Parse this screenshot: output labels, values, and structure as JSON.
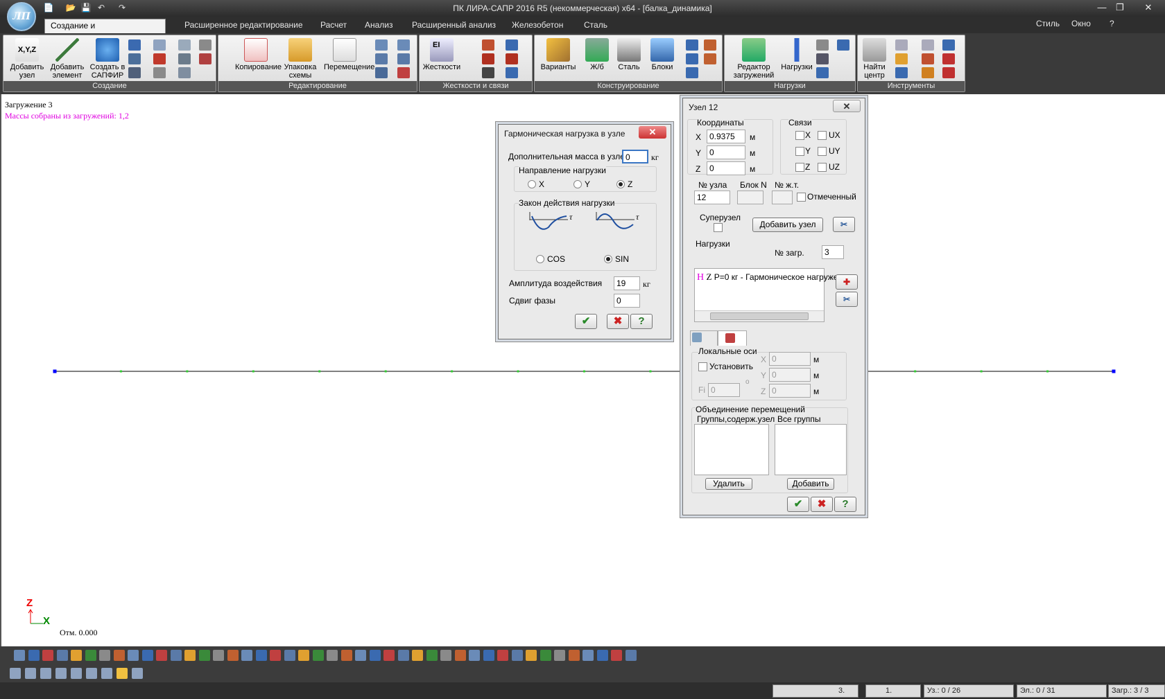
{
  "window": {
    "title": "ПК ЛИРА-САПР  2016 R5 (некоммерческая) x64 - [балка_динамика]",
    "app_logo": "ЛП",
    "minimize": "—",
    "maximize": "❐",
    "close": "✕"
  },
  "qat": {
    "new": "📄",
    "open": "📂",
    "save": "💾",
    "undo": "↶",
    "redo": "↷"
  },
  "tabs": [
    "Создание и редактирование",
    "Расширенное редактирование",
    "Расчет",
    "Анализ",
    "Расширенный анализ",
    "Железобетон",
    "Сталь"
  ],
  "right_menu": {
    "style": "Стиль",
    "window": "Окно",
    "help": "?"
  },
  "ribbon": {
    "groups": [
      "Создание",
      "Редактирование",
      "Жесткости и связи",
      "Конструирование",
      "Нагрузки",
      "Инструменты"
    ],
    "buttons": {
      "add_node": "Добавить\nузел",
      "add_element": "Добавить\nэлемент",
      "create_sapfir": "Создать в\nСАПФИР",
      "copy": "Копирование",
      "pack": "Упаковка\nсхемы",
      "move": "Перемещение",
      "stiffness": "Жесткости",
      "variants": "Варианты",
      "rc": "Ж/б",
      "steel": "Сталь",
      "blocks": "Блоки",
      "load_editor": "Редактор\nзагружений",
      "loads": "Нагрузки",
      "find_center": "Найти\nцентр"
    },
    "xyz_label": "X,Y,Z",
    "ei_label": "EI"
  },
  "canvas": {
    "load_case": "Загружение 3",
    "masses": "Массы собраны из загружений:  1,2",
    "elevation": "Отм. 0.000",
    "axis_z": "Z",
    "axis_x": "X"
  },
  "harmonic_dialog": {
    "title": "Гармоническая нагрузка в узле",
    "close": "✕",
    "extra_mass_label": "Дополнительная масса в узле",
    "extra_mass_value": "0",
    "unit_kg": "кг",
    "direction_label": "Направление нагрузки",
    "dir_x": "X",
    "dir_y": "Y",
    "dir_z": "Z",
    "dir_selected": "Z",
    "law_label": "Закон действия нагрузки",
    "cos": "COS",
    "sin": "SIN",
    "law_selected": "SIN",
    "tau": "τ",
    "amplitude_label": "Амплитуда воздействия",
    "amplitude_value": "19",
    "phase_label": "Сдвиг фазы",
    "phase_value": "0",
    "ok": "✔",
    "cancel": "✖",
    "help": "?"
  },
  "node_dialog": {
    "title": "Узел 12",
    "close": "✕",
    "coords_label": "Координаты",
    "x_label": "X",
    "x_value": "0.9375",
    "y_label": "Y",
    "y_value": "0",
    "z_label": "Z",
    "z_value": "0",
    "unit_m": "м",
    "links_label": "Связи",
    "lx": "X",
    "ly": "Y",
    "lz": "Z",
    "lux": "UX",
    "luy": "UY",
    "luz": "UZ",
    "node_no_label": "№ узла",
    "node_no_value": "12",
    "block_label": "Блок N",
    "jt_label": "№ ж.т.",
    "marked_label": "Отмеченный",
    "supernode_label": "Суперузел",
    "add_node_button": "Добавить узел",
    "loads_label": "Нагрузки",
    "load_no_label": "№ загр.",
    "load_no_value": "3",
    "load_item_prefix": "H",
    "load_item_dir": "Z",
    "load_item_text": "P=0 кг - Гармоническое нагруже",
    "local_axes_label": "Локальные оси",
    "set_label": "Установить",
    "fi_label": "Fi",
    "fi_value": "0",
    "deg": "o",
    "lx_label": "X",
    "ly_label": "Y",
    "lz_label": "Z",
    "lx_value": "0",
    "ly_value": "0",
    "lz_value": "0",
    "union_label": "Объединение перемещений",
    "groups_label": "Группы,содерж.узел",
    "all_groups_label": "Все группы",
    "delete_button": "Удалить",
    "add_button": "Добавить",
    "ok": "✔",
    "cancel": "✖",
    "help": "?"
  },
  "status": {
    "load_combo": "3.",
    "combo2": "1.",
    "nodes": "Уз.: 0 / 26",
    "elements": "Эл.: 0 / 31",
    "loadings": "Загр.: 3 / 3"
  },
  "colors": {
    "accent": "#3a76c4",
    "close_red": "#c8402f",
    "node_blue": "#0000ff",
    "node_green": "#33cc33",
    "magenta": "#e000e0"
  }
}
